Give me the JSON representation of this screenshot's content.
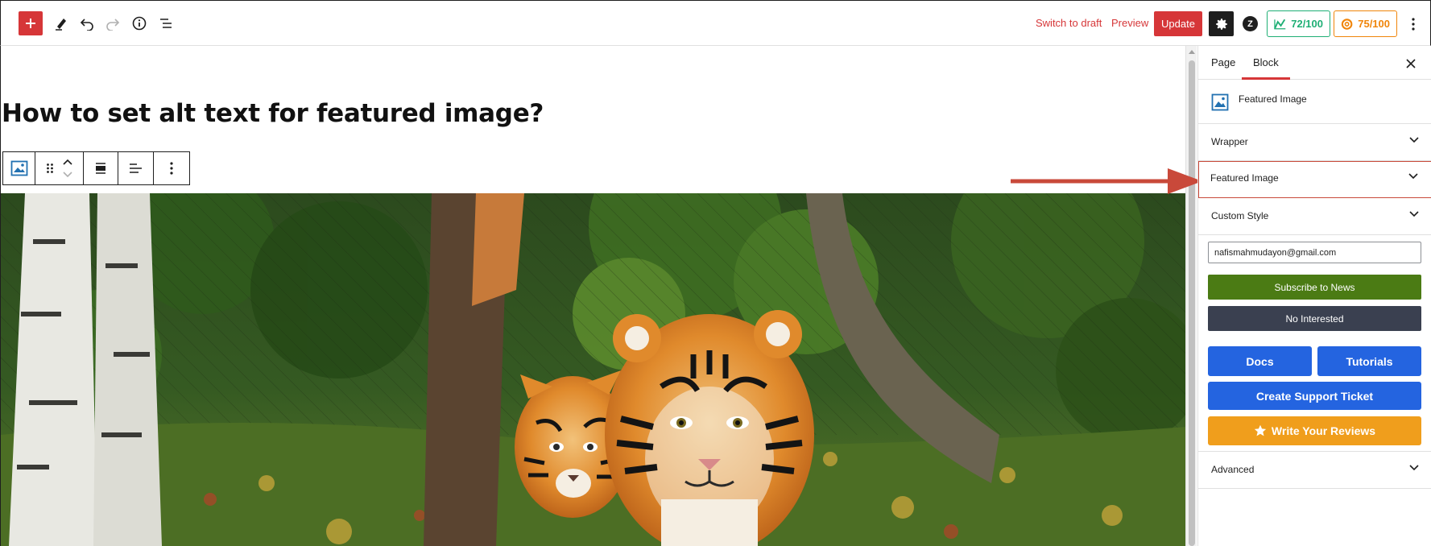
{
  "toolbar": {
    "switch_to_draft": "Switch to draft",
    "preview": "Preview",
    "update": "Update",
    "logo_letter": "Z",
    "score_seo": "72/100",
    "score_readability": "75/100",
    "icons": [
      "plus-icon",
      "pen-icon",
      "undo-icon",
      "redo-icon",
      "info-icon",
      "list-view-icon",
      "gear-icon",
      "kebab-icon"
    ],
    "accent": "#d63638"
  },
  "editor": {
    "post_title": "How to set alt text for featured image?",
    "block_toolbar_icons": [
      "image-icon",
      "drag-handle-icon",
      "move-up-icon",
      "move-down-icon",
      "align-center-icon",
      "align-left-icon",
      "more-options-icon"
    ]
  },
  "sidebar": {
    "tabs": [
      "Page",
      "Block"
    ],
    "active_tab": "Block",
    "block_name": "Featured Image",
    "panels": {
      "wrapper": "Wrapper",
      "featured_image": "Featured Image",
      "custom_style": "Custom Style",
      "advanced": "Advanced"
    },
    "email_value": "nafismahmudayon@gmail.com",
    "subscribe_label": "Subscribe to News",
    "no_interest_label": "No Interested",
    "docs_label": "Docs",
    "tutorials_label": "Tutorials",
    "ticket_label": "Create Support Ticket",
    "review_label": "Write Your Reviews"
  },
  "colors": {
    "update_red": "#d63638",
    "seo_green": "#1faf75",
    "readability_orange": "#f0850a",
    "subscribe_green": "#4b7b14",
    "no_interest_gray": "#3a4050",
    "primary_blue": "#2464e0",
    "review_orange": "#f09e1c",
    "annotation_arrow": "#c9493a"
  }
}
